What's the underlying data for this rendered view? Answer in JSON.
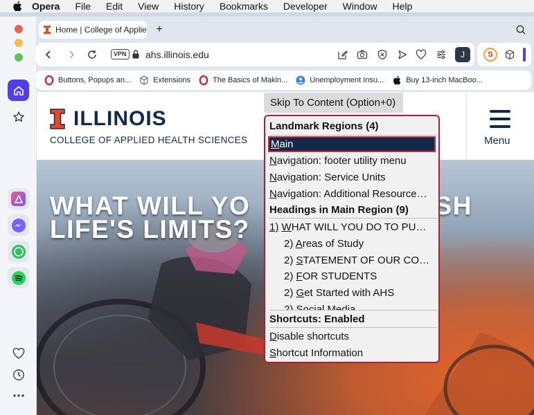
{
  "menubar": {
    "app": "Opera",
    "items": [
      "File",
      "Edit",
      "View",
      "History",
      "Bookmarks",
      "Developer",
      "Window",
      "Help"
    ]
  },
  "tab": {
    "title": "Home | College of Applie"
  },
  "address": {
    "vpn": "VPN",
    "url": "ahs.illinois.edu",
    "avatar": "J"
  },
  "bookmarks": [
    {
      "label": "Buttons, Popups an...",
      "icon": "opera-icon"
    },
    {
      "label": "Extensions",
      "icon": "cube-icon"
    },
    {
      "label": "The Basics of Makin...",
      "icon": "opera-icon"
    },
    {
      "label": "Unemployment Insu...",
      "icon": "person-icon"
    },
    {
      "label": "Buy 13-inch MacBoo...",
      "icon": "apple-icon"
    }
  ],
  "site": {
    "brand": "ILLINOIS",
    "college": "COLLEGE OF APPLIED HEALTH SCIENCES",
    "menu": "Menu",
    "hero_line1": "WHAT WILL YO",
    "hero_line1_end": "USH",
    "hero_line2": "LIFE'S LIMITS?"
  },
  "skip": "Skip To Content (Option+0)",
  "popup": {
    "landmarks_header": "Landmark Regions (4)",
    "landmarks": [
      {
        "key": "M",
        "rest": "ain"
      },
      {
        "key": "N",
        "rest": "avigation: footer utility menu"
      },
      {
        "key": "N",
        "rest": "avigation: Service Units"
      },
      {
        "key": "N",
        "rest": "avigation: Additional Resource…"
      }
    ],
    "headings_header": "Headings in Main Region (9)",
    "headings": [
      {
        "level": "1)",
        "key": "W",
        "rest": "HAT WILL YOU DO TO PU…"
      },
      {
        "level": "2)",
        "key": "A",
        "rest": "reas of Study"
      },
      {
        "level": "2)",
        "key": "S",
        "rest": "TATEMENT OF OUR CO…"
      },
      {
        "level": "2)",
        "key": "F",
        "rest": "OR STUDENTS"
      },
      {
        "level": "2)",
        "key": "G",
        "rest": "et Started with AHS"
      },
      {
        "level": "2)",
        "key": "S",
        "rest": "ocial Media"
      }
    ],
    "shortcuts_header": "Shortcuts: Enabled",
    "shortcuts": [
      {
        "key": "D",
        "rest": "isable shortcuts"
      },
      {
        "key": "S",
        "rest": "hortcut Information"
      }
    ]
  },
  "colors": {
    "illinois_blue": "#13294b",
    "illinois_orange": "#e84a27",
    "popup_border": "#b01e2d"
  }
}
